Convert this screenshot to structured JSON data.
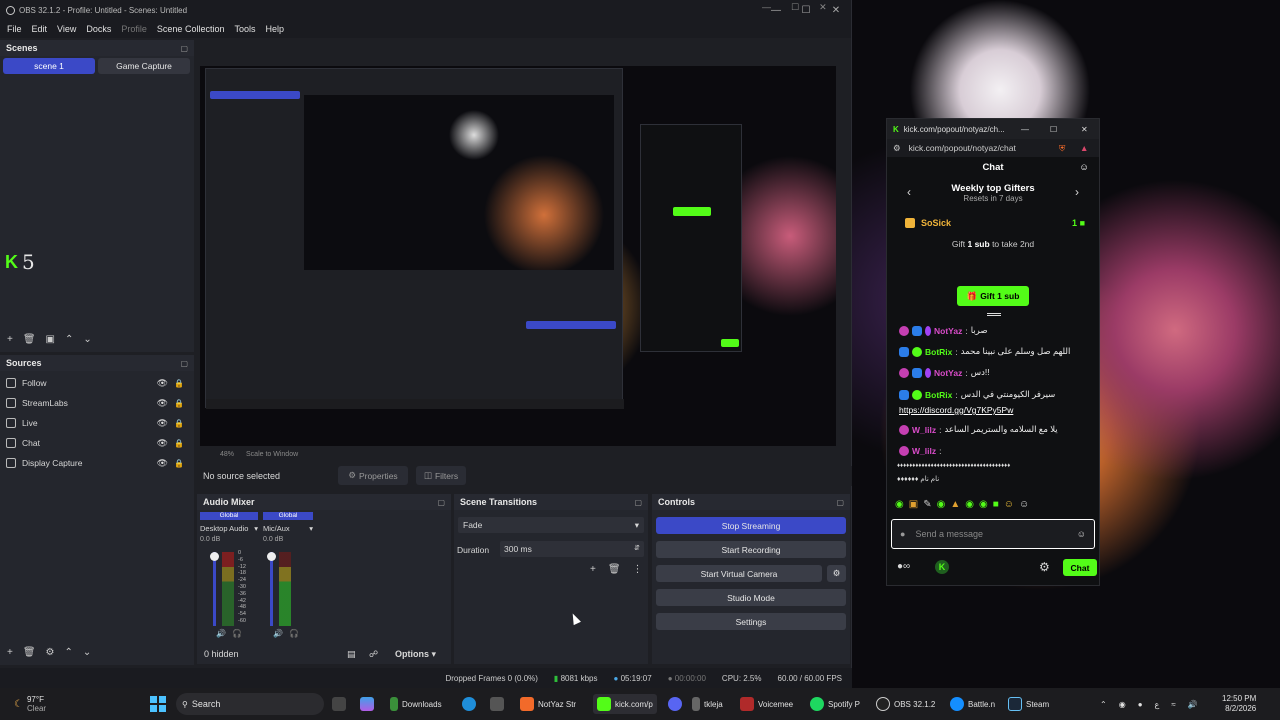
{
  "obs": {
    "title": "OBS 32.1.2 - Profile: Untitled - Scenes: Untitled",
    "menu": [
      "File",
      "Edit",
      "View",
      "Docks",
      "Profile",
      "Scene Collection",
      "Tools",
      "Help"
    ],
    "scenes": {
      "title": "Scenes",
      "items": [
        "scene 1",
        "Game Capture"
      ],
      "overlay_text": "5"
    },
    "sources": {
      "title": "Sources",
      "items": [
        "Follow",
        "StreamLabs",
        "Live",
        "Chat",
        "Display Capture"
      ]
    },
    "canvas_bar": {
      "no_source": "No source selected",
      "properties": "Properties",
      "filters": "Filters"
    },
    "audio_mixer": {
      "title": "Audio Mixer",
      "channels": [
        {
          "global": "Global",
          "name": "Desktop Audio",
          "db": "0.0 dB"
        },
        {
          "global": "Global",
          "name": "Mic/Aux",
          "db": "0.0 dB"
        }
      ],
      "scale": [
        "0",
        "-6",
        "-12",
        "-18",
        "-24",
        "-30",
        "-36",
        "-42",
        "-48",
        "-54",
        "-60"
      ],
      "hidden": "0 hidden",
      "options": "Options"
    },
    "scene_transitions": {
      "title": "Scene Transitions",
      "transition": "Fade",
      "duration_label": "Duration",
      "duration_value": "300 ms"
    },
    "controls": {
      "title": "Controls",
      "buttons": [
        "Stop Streaming",
        "Start Recording",
        "Start Virtual Camera",
        "Studio Mode",
        "Settings"
      ]
    },
    "status": {
      "dropped": "Dropped Frames 0 (0.0%)",
      "kbps": "8081 kbps",
      "stream_time": "05:19:07",
      "rec_time": "00:00:00",
      "cpu": "CPU: 2.5%",
      "fps": "60.00 / 60.00 FPS"
    },
    "preview": {
      "zoom": "48%",
      "scale": "Scale to Window"
    }
  },
  "kick": {
    "window_title": "kick.com/popout/notyaz/ch...",
    "url": "kick.com/popout/notyaz/chat",
    "header": "Chat",
    "gifters_title": "Weekly top Gifters",
    "gifters_sub": "Resets in 7 days",
    "top_gifter": "SoSick",
    "top_gifter_count": "1",
    "gift_prompt_pre": "Gift",
    "gift_prompt_bold": "1 sub",
    "gift_prompt_post": "to take 2nd",
    "gift_button": "Gift 1 sub",
    "messages": [
      {
        "user": "NotYaz",
        "text": "صربا",
        "color": "#d94cc9"
      },
      {
        "user": "BotRix",
        "text": "اللهم صل وسلم على نبينا محمد",
        "color": "#53fc18"
      },
      {
        "user": "NotYaz",
        "text": "دس!!",
        "color": "#d94cc9"
      },
      {
        "user": "BotRix",
        "text": "سيرفر الكيومنتي في الدس",
        "link": "https://discord.gg/Vg7KPy5Pw",
        "color": "#53fc18"
      },
      {
        "user": "W_lilz",
        "text": "يلا مع السلامه والستريمر الساعد",
        "color": "#d94cc9"
      },
      {
        "user": "W_lilz",
        "text": "",
        "color": "#d94cc9"
      }
    ],
    "spam_line": "♦♦♦♦♦♦♦♦♦♦♦♦♦♦♦♦♦♦♦♦♦♦♦♦♦♦♦♦♦♦♦♦♦♦♦♦♦",
    "spam_line2": "♦♦♦♦♦♦ نام نام",
    "input_placeholder": "Send a message",
    "chat_button": "Chat"
  },
  "taskbar": {
    "weather_temp": "97°F",
    "weather_desc": "Clear",
    "search": "Search",
    "apps": [
      "Downloads",
      "NotYaz Str",
      "kick.com/p",
      "tkleja",
      "Voicemee",
      "Spotify P",
      "OBS 32.1.2",
      "Battle.n",
      "Steam"
    ],
    "time": "12:50 PM",
    "date": "8/2/2026",
    "lang": "ع"
  }
}
